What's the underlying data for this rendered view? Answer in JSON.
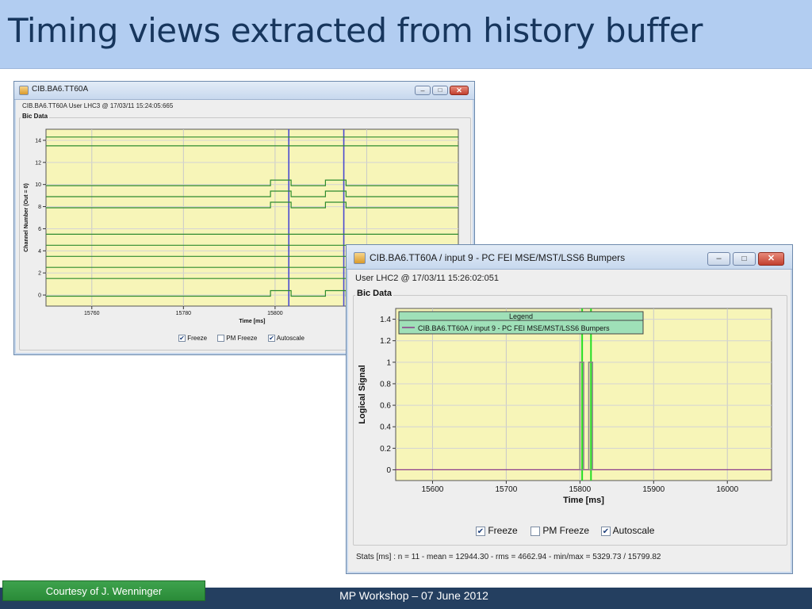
{
  "slide": {
    "title": "Timing views extracted from history buffer",
    "courtesy": "Courtesy of J. Wenninger",
    "footer": "MP Workshop  –  07 June 2012"
  },
  "window1": {
    "title": "CIB.BA6.TT60A",
    "subtitle": "CIB.BA6.TT60A User LHC3 @ 17/03/11 15:24:05:665",
    "group_label": "Bic Data",
    "icons": {
      "app": "java-app-icon",
      "minimize": "minimize-icon",
      "maximize": "maximize-icon",
      "close": "close-icon"
    },
    "checkboxes": [
      {
        "label": "Freeze",
        "checked": true
      },
      {
        "label": "PM Freeze",
        "checked": false
      },
      {
        "label": "Autoscale",
        "checked": true
      }
    ]
  },
  "window2": {
    "title": "CIB.BA6.TT60A / input 9 - PC FEI MSE/MST/LSS6 Bumpers",
    "subtitle": "User LHC2 @ 17/03/11 15:26:02:051",
    "group_label": "Bic Data",
    "icons": {
      "app": "java-app-icon",
      "minimize": "minimize-icon",
      "maximize": "maximize-icon",
      "close": "close-icon"
    },
    "checkboxes": [
      {
        "label": "Freeze",
        "checked": true
      },
      {
        "label": "PM Freeze",
        "checked": false
      },
      {
        "label": "Autoscale",
        "checked": true
      }
    ],
    "stats": "Stats [ms] : n = 11 -  mean = 12944.30 - rms = 4662.94 - min/max = 5329.73 / 15799.82"
  },
  "chart_data": [
    {
      "type": "line",
      "title": "",
      "xlabel": "Time [ms]",
      "ylabel": "Channel Number (Out = 0)",
      "xlim": [
        15750,
        15840
      ],
      "ylim": [
        -1,
        15
      ],
      "x_ticks": [
        15760,
        15780,
        15800,
        15820
      ],
      "y_ticks": [
        0,
        2,
        4,
        6,
        8,
        10,
        12,
        14
      ],
      "grid": true,
      "background": "#f7f5b8",
      "line_color": "#2e8b2e",
      "cursor_color": "#4a4ad0",
      "cursors_x": [
        15803,
        15815
      ],
      "series": [
        {
          "x": [
            15750,
            15840
          ],
          "y": [
            14.3,
            14.3
          ]
        },
        {
          "x": [
            15750,
            15840
          ],
          "y": [
            13.5,
            13.5
          ]
        },
        {
          "x": [
            15750,
            15799,
            15799,
            15803.5,
            15803.5,
            15811,
            15811,
            15815.5,
            15815.5,
            15840
          ],
          "y": [
            9.9,
            9.9,
            10.4,
            10.4,
            9.9,
            9.9,
            10.4,
            10.4,
            9.9,
            9.9
          ]
        },
        {
          "x": [
            15750,
            15799,
            15799,
            15803.5,
            15803.5,
            15811,
            15811,
            15815.5,
            15815.5,
            15840
          ],
          "y": [
            8.9,
            8.9,
            9.4,
            9.4,
            8.9,
            8.9,
            9.4,
            9.4,
            8.9,
            8.9
          ]
        },
        {
          "x": [
            15750,
            15799,
            15799,
            15803.5,
            15803.5,
            15811,
            15811,
            15815.5,
            15815.5,
            15840
          ],
          "y": [
            7.9,
            7.9,
            8.4,
            8.4,
            7.9,
            7.9,
            8.4,
            8.4,
            7.9,
            7.9
          ]
        },
        {
          "x": [
            15750,
            15840
          ],
          "y": [
            5.5,
            5.5
          ]
        },
        {
          "x": [
            15750,
            15840
          ],
          "y": [
            4.5,
            4.5
          ]
        },
        {
          "x": [
            15750,
            15840
          ],
          "y": [
            3.5,
            3.5
          ]
        },
        {
          "x": [
            15750,
            15840
          ],
          "y": [
            2.5,
            2.5
          ]
        },
        {
          "x": [
            15750,
            15840
          ],
          "y": [
            1.5,
            1.5
          ]
        },
        {
          "x": [
            15750,
            15799,
            15799,
            15803.5,
            15803.5,
            15811,
            15811,
            15815.5,
            15815.5,
            15840
          ],
          "y": [
            -0.1,
            -0.1,
            0.4,
            0.4,
            -0.1,
            -0.1,
            0.4,
            0.4,
            -0.1,
            -0.1
          ]
        }
      ]
    },
    {
      "type": "line",
      "title": "",
      "xlabel": "Time [ms]",
      "ylabel": "Logical Signal",
      "xlim": [
        15550,
        16060
      ],
      "ylim": [
        -0.1,
        1.5
      ],
      "x_ticks": [
        15600,
        15700,
        15800,
        15900,
        16000
      ],
      "y_ticks": [
        0,
        0.2,
        0.4,
        0.6,
        0.8,
        1,
        1.2,
        1.4
      ],
      "grid": true,
      "background": "#f7f5b8",
      "cursor_color": "#22dd22",
      "cursors_x": [
        15803,
        15815
      ],
      "legend": {
        "title": "Legend",
        "position": "top-left",
        "entries": [
          "CIB.BA6.TT60A / input 9 - PC FEI MSE/MST/LSS6 Bumpers"
        ]
      },
      "series": [
        {
          "name": "CIB.BA6.TT60A / input 9 - PC FEI MSE/MST/LSS6 Bumpers",
          "color": "#8b3a8b",
          "pulse_color": "#888888",
          "x": [
            15550,
            15800,
            15800,
            15805,
            15805,
            15812,
            15812,
            15817,
            15817,
            16060
          ],
          "y": [
            0,
            0,
            1,
            1,
            0,
            0,
            1,
            1,
            0,
            0
          ]
        }
      ]
    }
  ]
}
